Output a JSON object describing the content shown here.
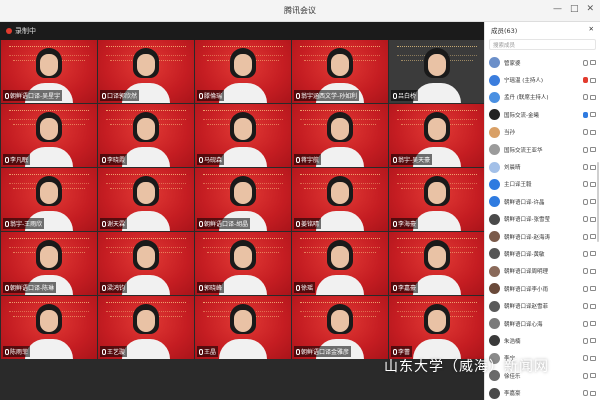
{
  "window": {
    "title": "腾讯会议",
    "controls": [
      "—",
      "□",
      "✕"
    ]
  },
  "recording": {
    "label": "录制中"
  },
  "tiles": [
    {
      "name": "朝鲜语口译-吴星宇",
      "dark": false
    },
    {
      "name": "口译郭欣然",
      "dark": false
    },
    {
      "name": "滕倫瑞",
      "dark": false
    },
    {
      "name": "翁宇涵西文学-孙如利",
      "dark": false
    },
    {
      "name": "吕白桥",
      "dark": true
    },
    {
      "name": "李凡眠",
      "dark": false
    },
    {
      "name": "李晓霞",
      "dark": false
    },
    {
      "name": "马砚森",
      "dark": false
    },
    {
      "name": "蒋宇航",
      "dark": false
    },
    {
      "name": "翁宇-吴天豪",
      "dark": false
    },
    {
      "name": "翁宇-王雨欣",
      "dark": false
    },
    {
      "name": "谢天霖",
      "dark": false
    },
    {
      "name": "朝鲜语口译-胡晶",
      "dark": false
    },
    {
      "name": "姜铭晴",
      "dark": false
    },
    {
      "name": "李海豪",
      "dark": false
    },
    {
      "name": "朝鲜语口译-陈琳",
      "dark": false
    },
    {
      "name": "梁鸿钧",
      "dark": false
    },
    {
      "name": "郭晓峰",
      "dark": false
    },
    {
      "name": "徐瑶",
      "dark": false
    },
    {
      "name": "李嘉豪",
      "dark": false
    },
    {
      "name": "陈雨菲",
      "dark": false
    },
    {
      "name": "王艺璇",
      "dark": false
    },
    {
      "name": "王晶",
      "dark": false
    },
    {
      "name": "朝鲜语口译金雅彦",
      "dark": false
    },
    {
      "name": "李蕾",
      "dark": false
    }
  ],
  "sidebar": {
    "title": "成员(63)",
    "search_placeholder": "搜索成员",
    "participants": [
      {
        "name": "管家婆",
        "avatar": "#6b8fc9",
        "mic": "gray"
      },
      {
        "name": "宁瑶温 (主持人)",
        "avatar": "#3b7ddd",
        "mic": "red"
      },
      {
        "name": "孟丹 (联席主持人)",
        "avatar": "#4a90e2",
        "mic": "gray"
      },
      {
        "name": "国际交流-金曦",
        "avatar": "#222222",
        "mic": "blue"
      },
      {
        "name": "当孙",
        "avatar": "#d9a066",
        "mic": "gray"
      },
      {
        "name": "国际交流王亚华",
        "avatar": "#9b9b9b",
        "mic": "gray"
      },
      {
        "name": "刘晨晴",
        "avatar": "#a3c0e8",
        "mic": "gray"
      },
      {
        "name": "主口译王毅",
        "avatar": "#2f7be0",
        "mic": "gray"
      },
      {
        "name": "朝鲜语口译-许晶",
        "avatar": "#2f7be0",
        "mic": "gray"
      },
      {
        "name": "朝鲜语口译-张雪莹",
        "avatar": "#4a4a4a",
        "mic": "gray"
      },
      {
        "name": "朝鲜语口译-赵海涛",
        "avatar": "#7a5a4a",
        "mic": "gray"
      },
      {
        "name": "朝鲜语口译-黄敏",
        "avatar": "#555555",
        "mic": "gray"
      },
      {
        "name": "朝鲜语口译周明理",
        "avatar": "#8a6a5a",
        "mic": "gray"
      },
      {
        "name": "朝鲜语口译李小雨",
        "avatar": "#6a4a3a",
        "mic": "gray"
      },
      {
        "name": "朝鲜语口译赵雪菲",
        "avatar": "#5a5a5a",
        "mic": "gray"
      },
      {
        "name": "朝鲜语口译心海",
        "avatar": "#7a7a7a",
        "mic": "gray"
      },
      {
        "name": "朱浩楠",
        "avatar": "#3a3a3a",
        "mic": "gray"
      },
      {
        "name": "李宁",
        "avatar": "#8a8a8a",
        "mic": "gray"
      },
      {
        "name": "徐佳乐",
        "avatar": "#6a6a6a",
        "mic": "gray"
      },
      {
        "name": "李嘉豪",
        "avatar": "#4a4a4a",
        "mic": "gray"
      }
    ]
  },
  "watermark": "山东大学（威海）新闻网"
}
